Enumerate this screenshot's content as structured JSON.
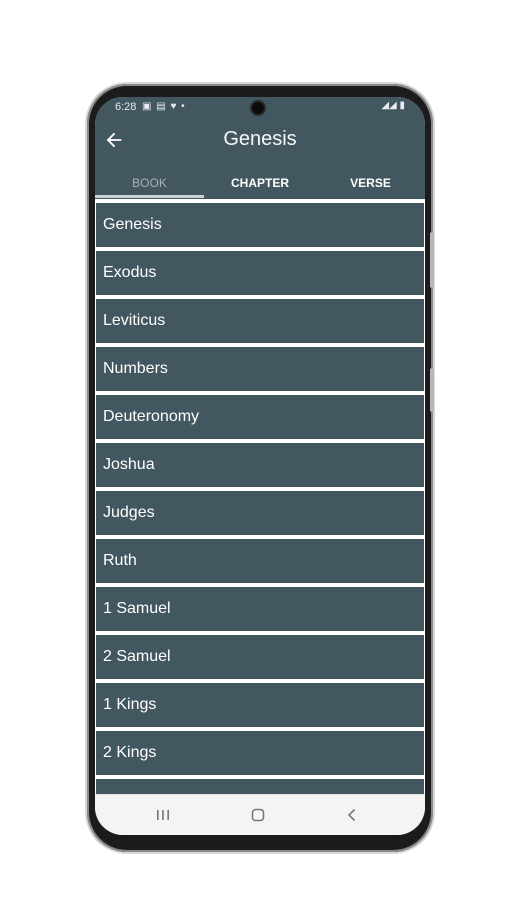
{
  "status": {
    "time": "6:28",
    "left_icons": "▣ ▤ ♥ •",
    "right_icons": "◢◢ ▮"
  },
  "header": {
    "title": "Genesis",
    "back_icon": "arrow-left-icon"
  },
  "tabs": [
    {
      "label": "BOOK",
      "active": true
    },
    {
      "label": "CHAPTER",
      "active": false
    },
    {
      "label": "VERSE",
      "active": false
    }
  ],
  "books": [
    "Genesis",
    "Exodus",
    "Leviticus",
    "Numbers",
    "Deuteronomy",
    "Joshua",
    "Judges",
    "Ruth",
    "1 Samuel",
    "2 Samuel",
    "1 Kings",
    "2 Kings",
    ""
  ],
  "navbar": {
    "recents_icon": "recents-icon",
    "home_icon": "home-icon",
    "back_icon": "back-chevron-icon"
  },
  "colors": {
    "bar": "#435760",
    "list_item": "#435760",
    "screen_bg": "#ffffff"
  }
}
